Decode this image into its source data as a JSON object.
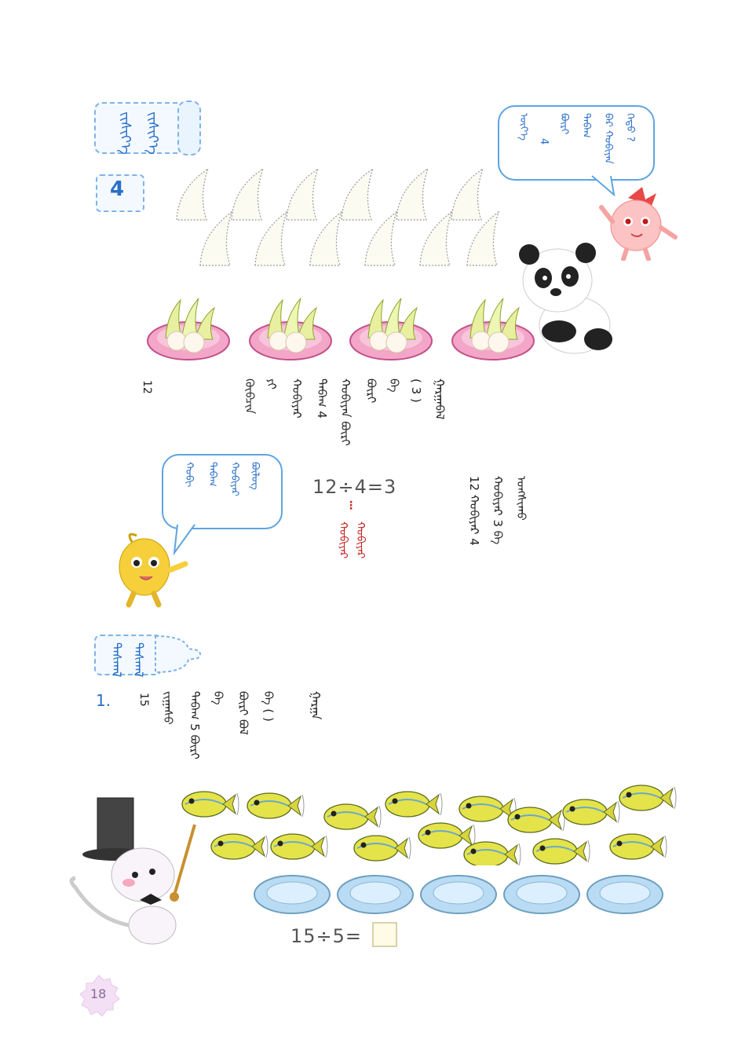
{
  "section_title": {
    "left": "ᠵᠢᠱᠢᠶ᠎ᠡ",
    "right": "ᠵᠢᠱᠢᠶ᠎ᠡ"
  },
  "example_number": "4",
  "bubble_top": [
    "ᠬᠡᠳᠦ ?",
    "ᠪᠡᠷ ᠬᠤᠪᠢᠶᠠᠨ",
    "ᠲᠠᠪᠠᠭ",
    "ᠪᠦᠷᠢ",
    "4",
    "ᠦᠶ᠎ᠡ"
  ],
  "problem_lines": [
    "ᠭᠠᠷᠭᠠᠪᠠᠯ",
    "( 3 )",
    "ᠪᠠ",
    "ᠪᠦᠷᠢ",
    "ᠬᠤᠪᠢᠶᠠᠨ ᠪᠦᠷᠢ",
    "ᠲᠠᠪᠠᠭ 4",
    "ᠬᠤᠪᠢᠶᠠᠷ",
    "ᠶᠢ",
    "ᠬᠦᠪᠴᠢᠨ",
    "12"
  ],
  "bubble_left": [
    "ᠪᠦᠯᠦᠭ",
    "ᠬᠤᠪᠢᠶᠠᠷ",
    "ᠲᠠᠪᠠᠭ",
    "ᠬᠤᠪᠢ"
  ],
  "equation_main": "12÷4=3",
  "equation_note": "ᠬᠤᠪᠢᠶᠠᠷ",
  "reading_lines": [
    "ᠤᠩᠱᠢᠬᠤ",
    "ᠬᠤᠪᠢᠶᠠᠷ 3 ᠪᠠ",
    "12 ᠬᠤᠪᠢᠶᠠᠷ 4"
  ],
  "exercise_title": {
    "left": "ᠳᠠᠰᠬᠠᠯ",
    "right": "ᠳᠠᠰᠬᠠᠯ"
  },
  "exercise_number": "1.",
  "exercise_lines": [
    "ᠭᠠᠷᠭᠠ",
    "ᠪᠠ ( )",
    "ᠪᠦᠷᠢ ᠪᠤᠯ",
    "ᠪᠠ",
    "ᠲᠠᠪᠠᠭ 5 ᠪᠦᠷᠢ",
    "ᠵᠢᠭᠠᠰᠤ",
    "15"
  ],
  "equation_exercise": "15÷5=",
  "page_number": "18",
  "colors": {
    "accent": "#2a6fc8",
    "note": "#c62828",
    "badge": "#f3e0f5"
  }
}
